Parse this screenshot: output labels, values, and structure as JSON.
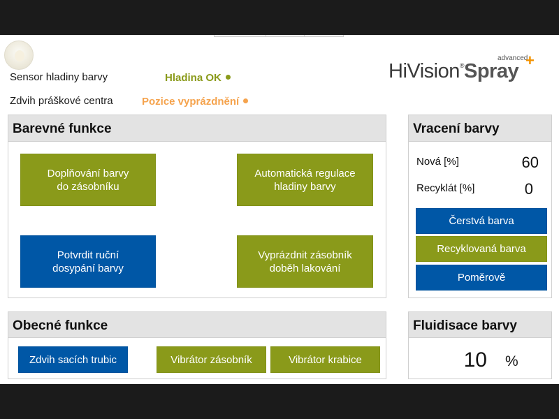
{
  "status": {
    "sensor_label": "Sensor hladiny barvy",
    "sensor_value": "Hladina OK",
    "lift_label": "Zdvih práškové centra",
    "lift_value": "Pozice vyprázdnění",
    "ok_color": "#8a9a1a",
    "warn_color": "#f5a34d"
  },
  "logo": {
    "hivision": "HiVision",
    "reg": "®",
    "spray": "Spray",
    "advanced": "advanced"
  },
  "colors": {
    "olive": "#8a9a1a",
    "blue": "#0057a6",
    "panel_header": "#e3e3e3"
  },
  "barevne": {
    "title": "Barevné funkce",
    "buttons": [
      {
        "label": "Doplňování barvy\ndo zásobníku",
        "color": "olive"
      },
      {
        "label": "Automatická regulace\nhladiny barvy",
        "color": "olive"
      },
      {
        "label": "Potvrdit ruční\ndosypání barvy",
        "color": "blue"
      },
      {
        "label": "Vyprázdnit zásobník\ndoběh lakování",
        "color": "olive"
      }
    ]
  },
  "vraceni": {
    "title": "Vracení barvy",
    "nova_label": "Nová [%]",
    "nova_value": "60",
    "recyklat_label": "Recyklát [%]",
    "recyklat_value": "0",
    "buttons": [
      {
        "label": "Čerstvá barva",
        "color": "blue"
      },
      {
        "label": "Recyklovaná barva",
        "color": "olive"
      },
      {
        "label": "Poměrově",
        "color": "blue"
      }
    ]
  },
  "obecne": {
    "title": "Obecné funkce",
    "buttons": [
      {
        "label": "Zdvih sacích trubic",
        "color": "blue"
      },
      {
        "label": "Vibrátor zásobník",
        "color": "olive"
      },
      {
        "label": "Vibrátor krabice",
        "color": "olive"
      }
    ]
  },
  "fluidisace": {
    "title": "Fluidisace barvy",
    "value": "10",
    "unit": "%"
  }
}
